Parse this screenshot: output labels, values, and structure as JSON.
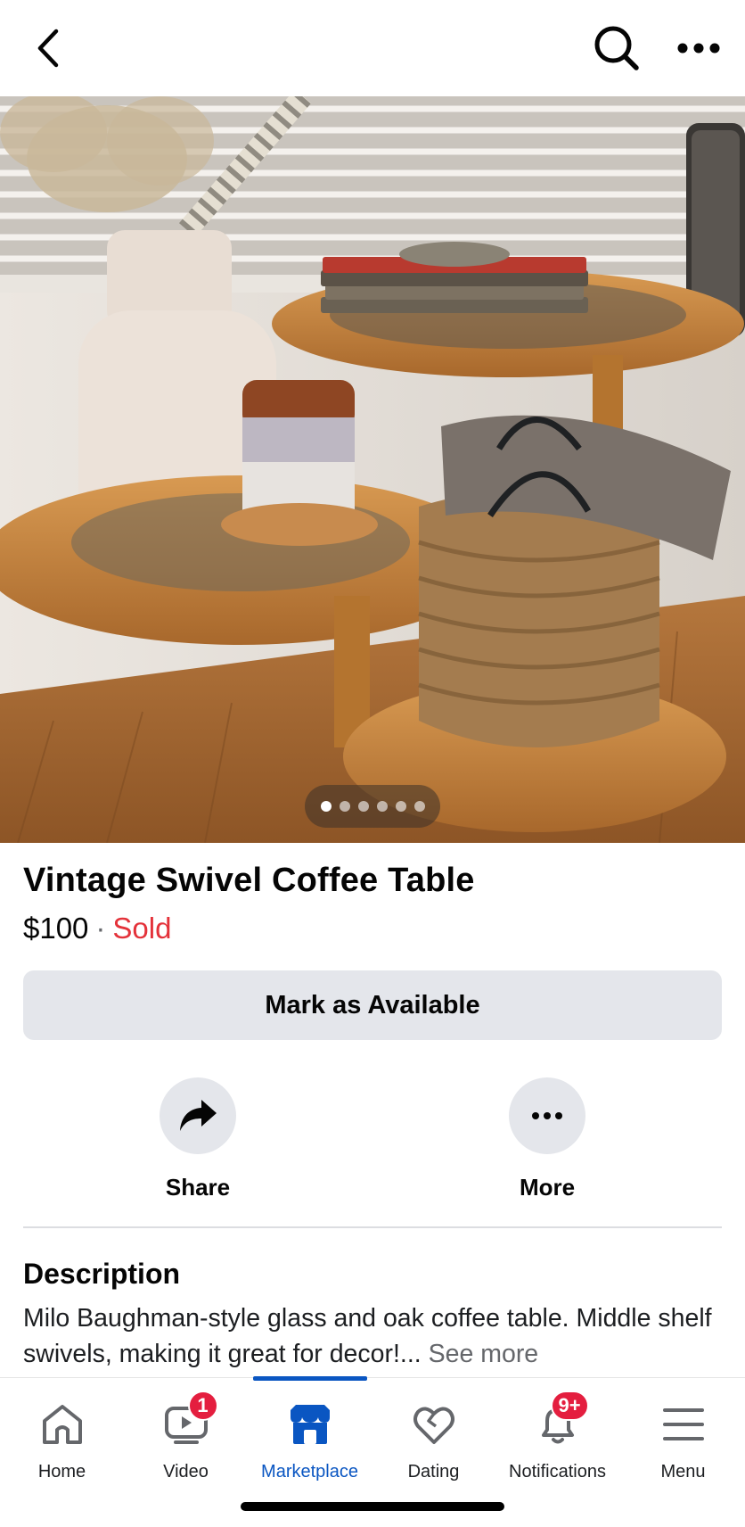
{
  "listing": {
    "title": "Vintage Swivel Coffee Table",
    "price": "$100",
    "separator": "·",
    "status": "Sold",
    "mark_button": "Mark as Available",
    "photo_count": 6,
    "photo_index": 1
  },
  "actions": {
    "share_label": "Share",
    "more_label": "More"
  },
  "description": {
    "heading": "Description",
    "text": "Milo Baughman-style glass and oak coffee table. Middle shelf swivels, making it great for decor!...",
    "see_more": "See more"
  },
  "bottom_nav": {
    "active": "Marketplace",
    "items": [
      {
        "label": "Home",
        "icon": "home-icon"
      },
      {
        "label": "Video",
        "icon": "video-icon",
        "badge": "1"
      },
      {
        "label": "Marketplace",
        "icon": "marketplace-icon"
      },
      {
        "label": "Dating",
        "icon": "dating-icon"
      },
      {
        "label": "Notifications",
        "icon": "bell-icon",
        "badge": "9+"
      },
      {
        "label": "Menu",
        "icon": "menu-icon"
      }
    ]
  },
  "colors": {
    "accent": "#0a56c2",
    "sold": "#e4323a",
    "badge": "#e41e3f",
    "button_bg": "#e4e6eb"
  }
}
